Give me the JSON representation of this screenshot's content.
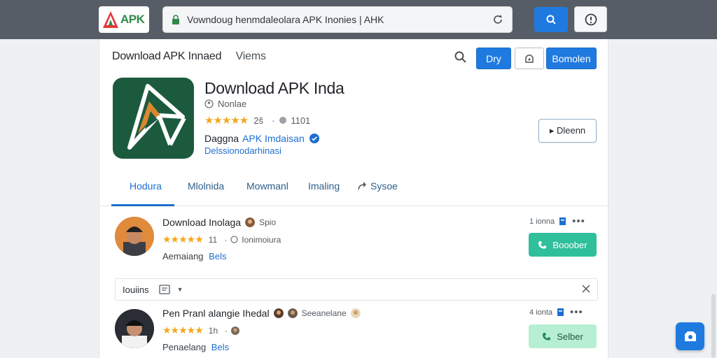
{
  "browser": {
    "logo_text": "APK",
    "url": "Vowndoug henmdaleolara APK  Inonies | AHK"
  },
  "header": {
    "title": "Download APK",
    "subtitle": "Innaed",
    "nav_link": "Viems",
    "btn_primary": "Dry",
    "btn_right": "Bomolen"
  },
  "app": {
    "name": "Download APK Inda",
    "sub_label": "Nonlae",
    "stars": "★★★★★",
    "rating_count": "2š",
    "extra_count": "1101",
    "developer_prefix": "Daggna",
    "developer_name": "APK Imdaisan",
    "developer_sub": "Delssionodarhinasi",
    "side_button": "▸ Dleenn"
  },
  "tabs": [
    {
      "label": "Hodura"
    },
    {
      "label": "Mlolnida"
    },
    {
      "label": "Mowmanl"
    },
    {
      "label": "Imaling"
    },
    {
      "label": "Sysoe"
    }
  ],
  "entries": [
    {
      "title": "Download Inolaga",
      "tag": "Spio",
      "stars": "★★★★★",
      "count": "11",
      "location": "Ionimoiura",
      "meta_label": "Aemaiang",
      "meta_link": "Bels",
      "right_label": "1 ionna",
      "button": "Booober",
      "button_color": "#2fbf9b"
    },
    {
      "title": "Pen Pranl alangie Ihedal",
      "tag": "Seeanelane",
      "stars": "★★★★★",
      "count": "1h",
      "location": "",
      "meta_label": "Penaelang",
      "meta_link": "Bels",
      "right_label": "4 ionta",
      "button": "Selber",
      "button_color": "#9fe6c4"
    }
  ],
  "filter": {
    "label": "Iouiins"
  }
}
